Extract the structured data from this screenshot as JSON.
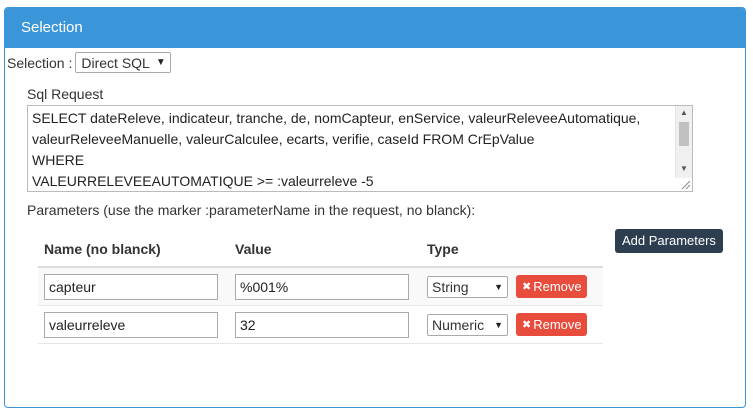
{
  "panel": {
    "title": "Selection"
  },
  "selection": {
    "label": "Selection :",
    "value": "Direct SQL"
  },
  "sql": {
    "label": "Sql Request",
    "text": "SELECT dateReleve, indicateur, tranche, de, nomCapteur, enService, valeurReleveeAutomatique, valeurReleveeManuelle, valeurCalculee, ecarts, verifie, caseId FROM CrEpValue\nWHERE\nVALEURRELEVEEAUTOMATIQUE >= :valeurreleve -5"
  },
  "parameters": {
    "label": "Parameters (use the marker :parameterName in the request, no blanck):",
    "add_label": "Add Parameters",
    "headers": {
      "name": "Name (no blanck)",
      "value": "Value",
      "type": "Type"
    },
    "remove_label": "Remove",
    "rows": [
      {
        "name": "capteur",
        "value": "%001%",
        "type": "String"
      },
      {
        "name": "valeurreleve",
        "value": "32",
        "type": "Numeric"
      }
    ]
  },
  "colors": {
    "header": "#3a96d9",
    "remove": "#e74c3c",
    "add": "#2c3e50"
  }
}
